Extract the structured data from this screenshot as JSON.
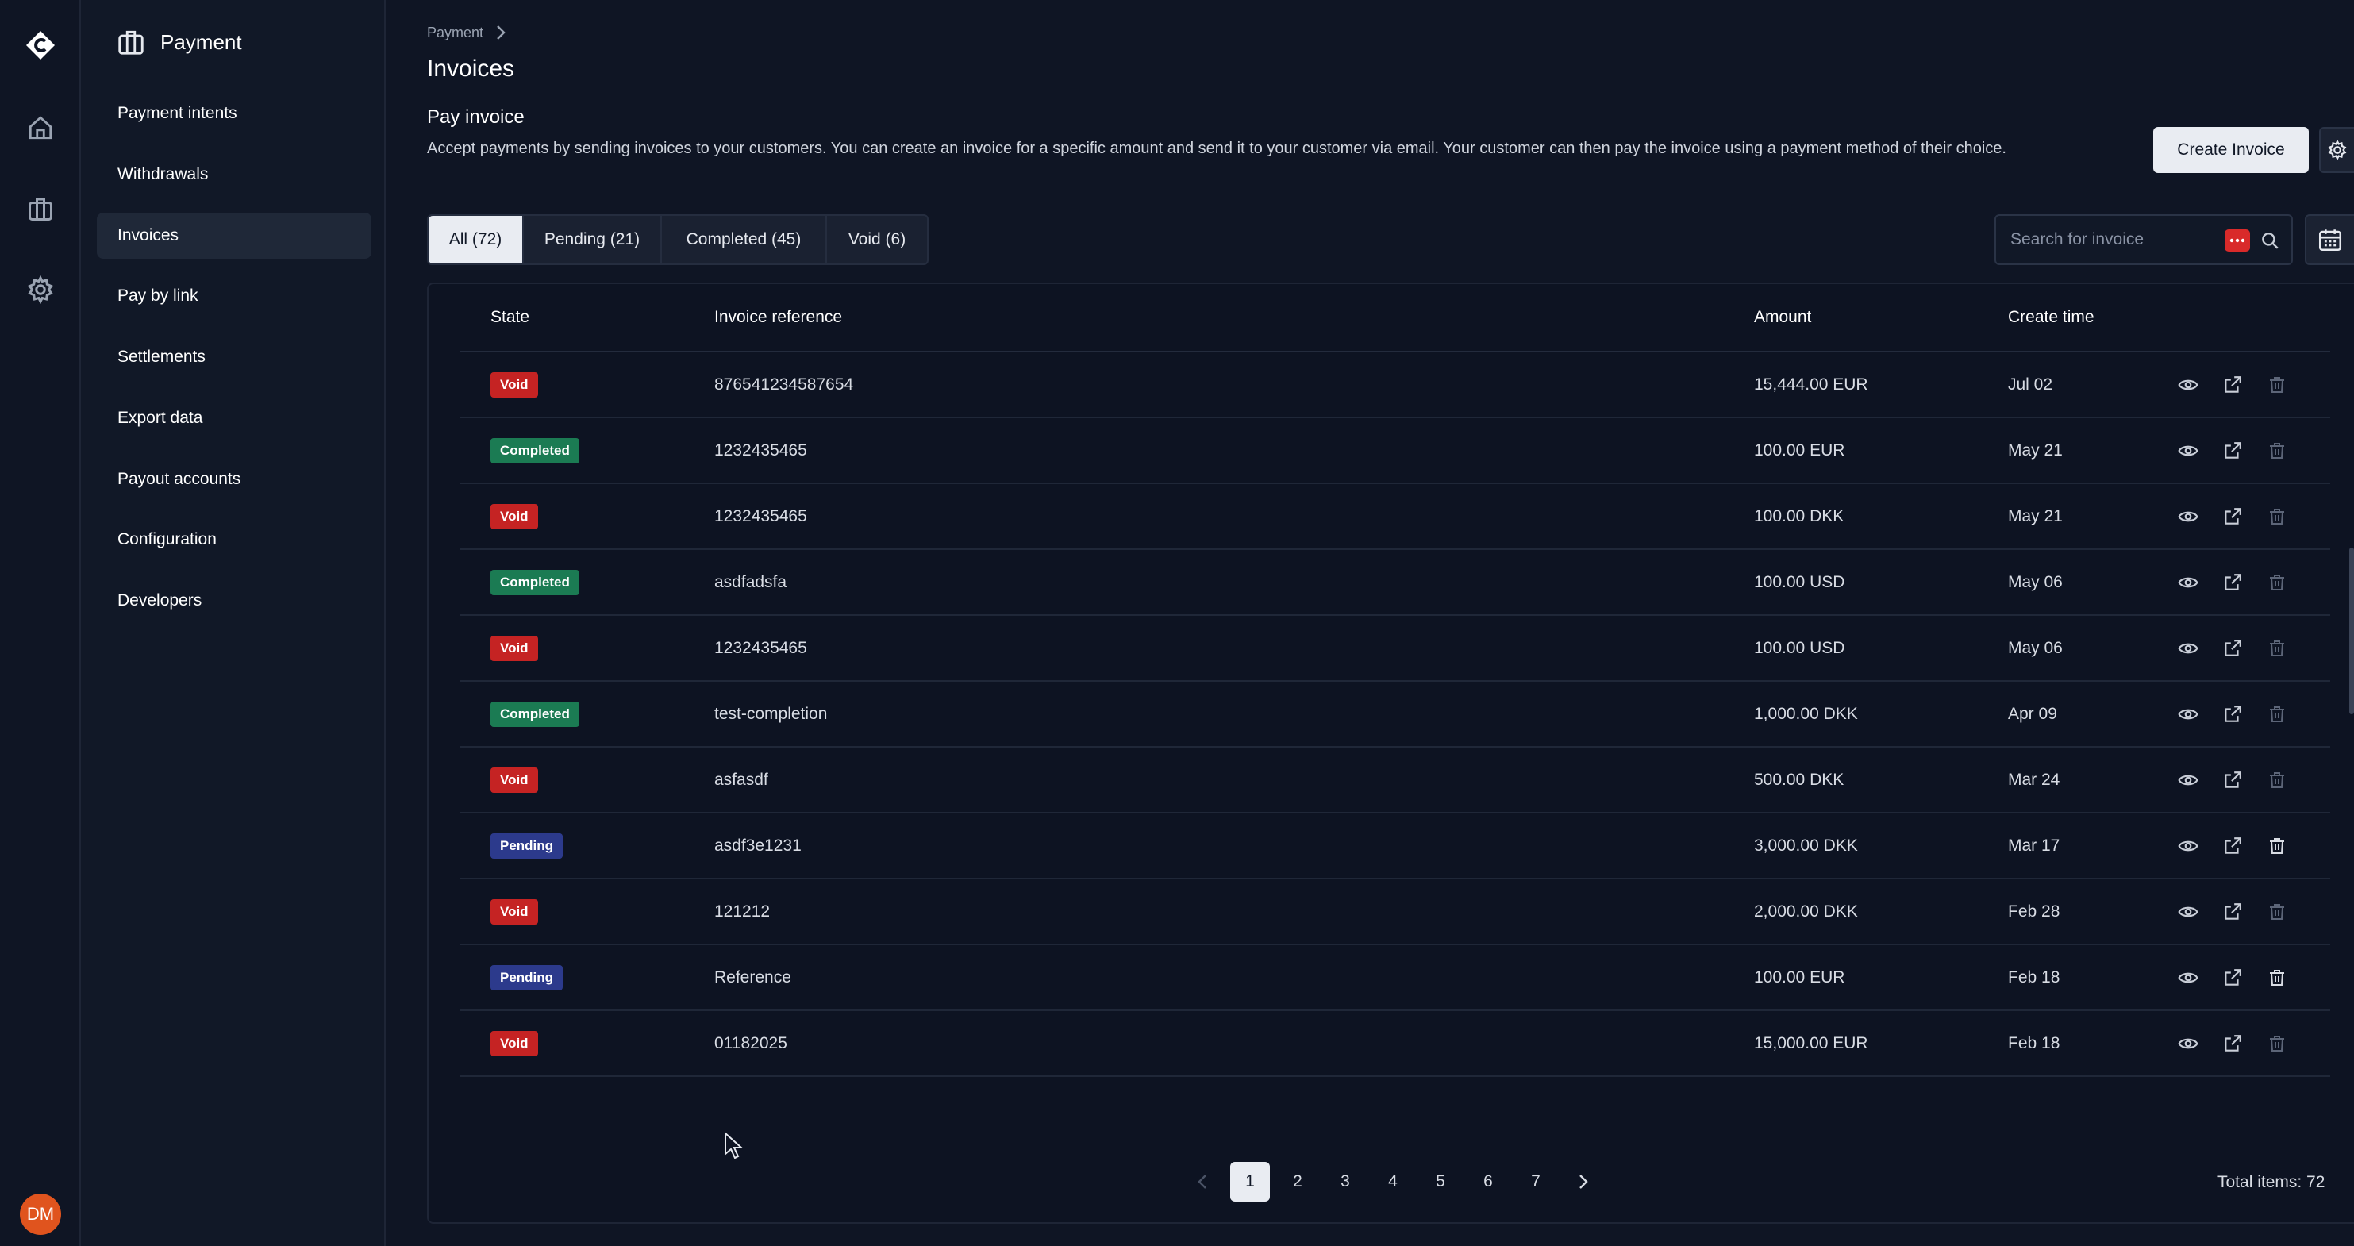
{
  "sidebar": {
    "title": "Payment",
    "items": [
      {
        "label": "Payment intents"
      },
      {
        "label": "Withdrawals"
      },
      {
        "label": "Invoices",
        "active": true
      },
      {
        "label": "Pay by link"
      },
      {
        "label": "Settlements"
      },
      {
        "label": "Export data"
      },
      {
        "label": "Payout accounts"
      },
      {
        "label": "Configuration"
      },
      {
        "label": "Developers"
      }
    ]
  },
  "rail": {
    "icons": [
      "logo-icon",
      "home-icon",
      "briefcase-icon",
      "gear-icon"
    ],
    "avatar_initials": "DM",
    "avatar_color": "#e0541e"
  },
  "breadcrumb": {
    "item": "Payment"
  },
  "page_title": "Invoices",
  "section": {
    "title": "Pay invoice",
    "description": "Accept payments by sending invoices to your customers. You can create an invoice for a specific amount and send it to your customer via email. Your customer can then pay the invoice using a payment method of their choice."
  },
  "actions": {
    "create_label": "Create Invoice"
  },
  "tabs": [
    {
      "label": "All (72)",
      "active": true
    },
    {
      "label": "Pending (21)"
    },
    {
      "label": "Completed (45)"
    },
    {
      "label": "Void (6)"
    }
  ],
  "search": {
    "placeholder": "Search for invoice",
    "value": ""
  },
  "table": {
    "headers": {
      "state": "State",
      "reference": "Invoice reference",
      "amount": "Amount",
      "time": "Create time"
    },
    "rows": [
      {
        "state": "Void",
        "reference": "876541234587654",
        "amount": "15,444.00 EUR",
        "time": "Jul 02"
      },
      {
        "state": "Completed",
        "reference": "1232435465",
        "amount": "100.00 EUR",
        "time": "May 21"
      },
      {
        "state": "Void",
        "reference": "1232435465",
        "amount": "100.00 DKK",
        "time": "May 21"
      },
      {
        "state": "Completed",
        "reference": "asdfadsfa",
        "amount": "100.00 USD",
        "time": "May 06"
      },
      {
        "state": "Void",
        "reference": "1232435465",
        "amount": "100.00 USD",
        "time": "May 06"
      },
      {
        "state": "Completed",
        "reference": "test-completion",
        "amount": "1,000.00 DKK",
        "time": "Apr 09"
      },
      {
        "state": "Void",
        "reference": "asfasdf",
        "amount": "500.00 DKK",
        "time": "Mar 24"
      },
      {
        "state": "Pending",
        "reference": "asdf3e1231",
        "amount": "3,000.00 DKK",
        "time": "Mar 17"
      },
      {
        "state": "Void",
        "reference": "121212",
        "amount": "2,000.00 DKK",
        "time": "Feb 28"
      },
      {
        "state": "Pending",
        "reference": "Reference",
        "amount": "100.00 EUR",
        "time": "Feb 18"
      },
      {
        "state": "Void",
        "reference": "01182025",
        "amount": "15,000.00 EUR",
        "time": "Feb 18"
      }
    ],
    "row_actions": [
      "eye-icon",
      "external-link-icon",
      "trash-icon"
    ]
  },
  "pagination": {
    "pages": [
      "1",
      "2",
      "3",
      "4",
      "5",
      "6",
      "7"
    ],
    "current": "1",
    "total_text": "Total items: 72"
  },
  "colors": {
    "void": "#c52323",
    "completed": "#1b7b53",
    "pending": "#2c3a8c",
    "background": "#0f1524"
  }
}
